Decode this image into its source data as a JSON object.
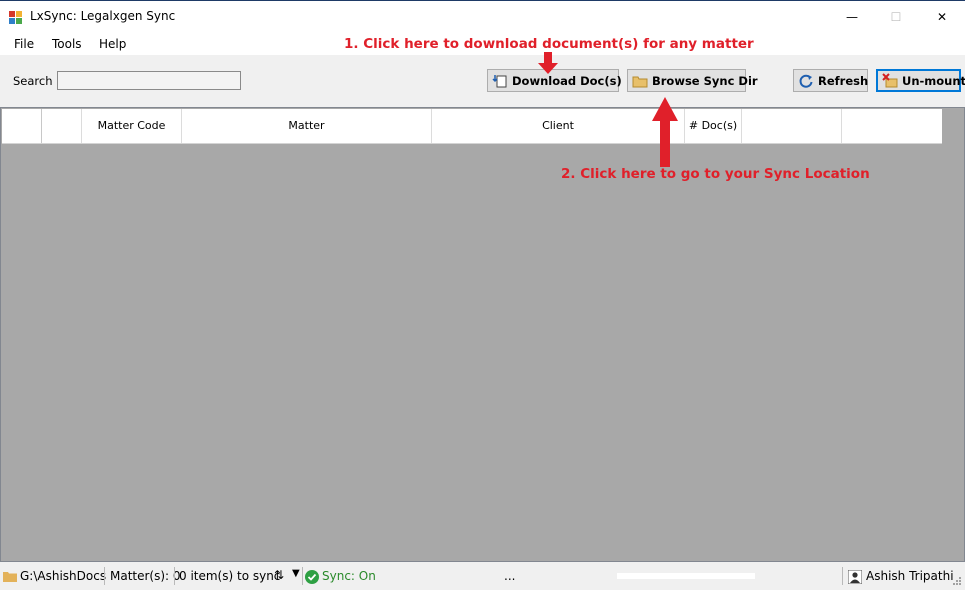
{
  "window": {
    "title": "LxSync: Legalxgen Sync",
    "minimize_glyph": "—",
    "maximize_glyph": "☐",
    "close_glyph": "✕"
  },
  "menu": {
    "file": "File",
    "tools": "Tools",
    "help": "Help"
  },
  "annotations": {
    "step1": "1. Click here to download document(s) for any matter",
    "step2": "2. Click here to go to your Sync Location",
    "color": "#e0202a"
  },
  "toolbar": {
    "search_label": "Search",
    "search_value": "",
    "download_label": "Download Doc(s)",
    "browse_label": "Browse Sync Dir",
    "refresh_label": "Refresh",
    "unmount_label": "Un-mount"
  },
  "grid": {
    "columns": [
      "",
      "",
      "Matter Code",
      "Matter",
      "Client",
      "# Doc(s)",
      "",
      ""
    ],
    "rows": []
  },
  "statusbar": {
    "path": "G:\\AshishDocs",
    "matters": "Matter(s): 0",
    "items_to_sync": "0 item(s) to sync",
    "sync_toggle_glyph": "⇅",
    "dropdown_glyph": "▼",
    "sync_status": "Sync: On",
    "ellipsis": "...",
    "user": "Ashish Tripathi"
  },
  "colors": {
    "grid_background": "#a8a8a8",
    "sync_on": "#2a8a2a",
    "focus_border": "#0078d7"
  },
  "icons": [
    "app-icon",
    "download-icon",
    "folder-icon",
    "refresh-icon",
    "unmount-icon",
    "check-icon",
    "user-icon"
  ]
}
